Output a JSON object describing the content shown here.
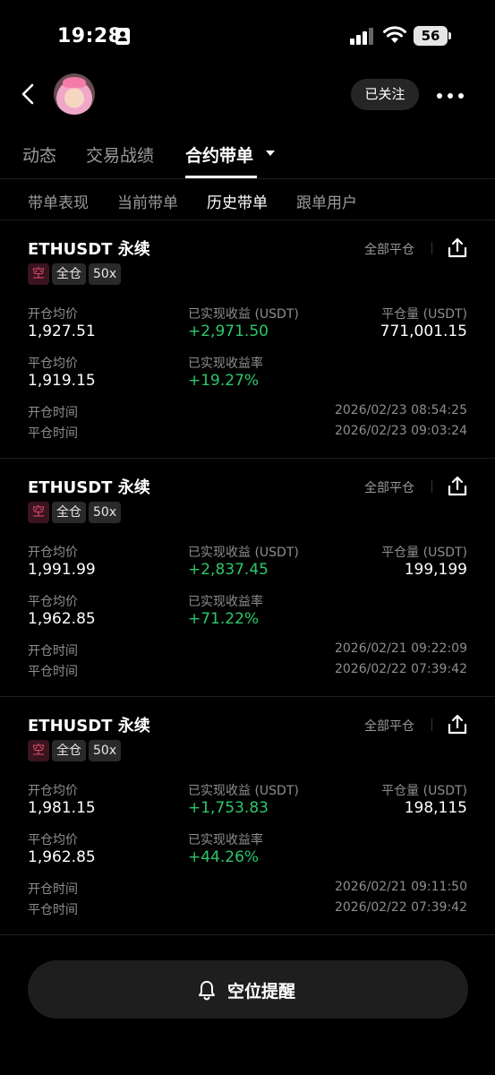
{
  "status_bar": {
    "time": "19:28",
    "battery": "56"
  },
  "header": {
    "follow_label": "已关注"
  },
  "tabs": [
    {
      "label": "动态"
    },
    {
      "label": "交易战绩"
    },
    {
      "label": "合约带单"
    }
  ],
  "subtabs": [
    {
      "label": "带单表现"
    },
    {
      "label": "当前带单"
    },
    {
      "label": "历史带单"
    },
    {
      "label": "跟单用户"
    }
  ],
  "labels": {
    "close_all": "全部平仓",
    "open_avg": "开仓均价",
    "close_avg": "平仓均价",
    "pnl": "已实现收益 (USDT)",
    "pnl_rate": "已实现收益率",
    "close_amount": "平仓量 (USDT)",
    "open_time": "开仓时间",
    "close_time": "平仓时间"
  },
  "positions": [
    {
      "symbol": "ETHUSDT 永续",
      "side": "空",
      "margin_mode": "全仓",
      "leverage": "50x",
      "open_avg": "1,927.51",
      "close_avg": "1,919.15",
      "pnl": "+2,971.50",
      "pnl_rate": "+19.27%",
      "close_amount": "771,001.15",
      "open_time": "2026/02/23 08:54:25",
      "close_time": "2026/02/23 09:03:24"
    },
    {
      "symbol": "ETHUSDT 永续",
      "side": "空",
      "margin_mode": "全仓",
      "leverage": "50x",
      "open_avg": "1,991.99",
      "close_avg": "1,962.85",
      "pnl": "+2,837.45",
      "pnl_rate": "+71.22%",
      "close_amount": "199,199",
      "open_time": "2026/02/21 09:22:09",
      "close_time": "2026/02/22 07:39:42"
    },
    {
      "symbol": "ETHUSDT 永续",
      "side": "空",
      "margin_mode": "全仓",
      "leverage": "50x",
      "open_avg": "1,981.15",
      "close_avg": "1,962.85",
      "pnl": "+1,753.83",
      "pnl_rate": "+44.26%",
      "close_amount": "198,115",
      "open_time": "2026/02/21 09:11:50",
      "close_time": "2026/02/22 07:39:42"
    }
  ],
  "bottom": {
    "alert_label": "空位提醒"
  },
  "colors": {
    "profit": "#2ec76b",
    "short": "#e04a6a",
    "background": "#000000"
  }
}
